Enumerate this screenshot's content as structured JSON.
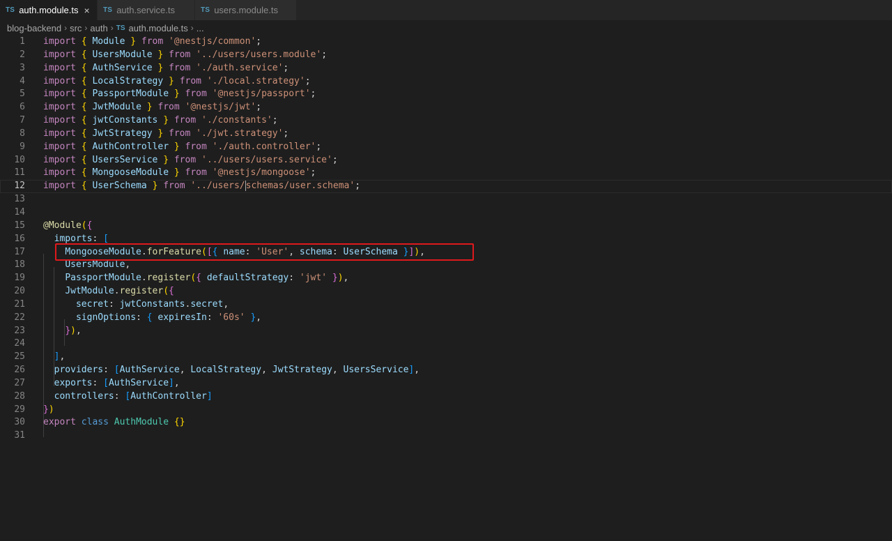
{
  "tabs": [
    {
      "icon": "TS",
      "label": "auth.module.ts",
      "active": true,
      "close": "×"
    },
    {
      "icon": "TS",
      "label": "auth.service.ts",
      "active": false
    },
    {
      "icon": "TS",
      "label": "users.module.ts",
      "active": false
    }
  ],
  "breadcrumb": {
    "items": [
      "blog-backend",
      "src",
      "auth"
    ],
    "file_icon": "TS",
    "file": "auth.module.ts",
    "ellipsis": "..."
  },
  "editor": {
    "current_line": 12,
    "lines": [
      {
        "n": "1",
        "t": [
          [
            "k",
            "import"
          ],
          [
            "p",
            " "
          ],
          [
            "b1",
            "{"
          ],
          [
            "p",
            " "
          ],
          [
            "var",
            "Module"
          ],
          [
            "p",
            " "
          ],
          [
            "b1",
            "}"
          ],
          [
            "p",
            " "
          ],
          [
            "k",
            "from"
          ],
          [
            "p",
            " "
          ],
          [
            "str",
            "'@nestjs/common'"
          ],
          [
            "p",
            ";"
          ]
        ]
      },
      {
        "n": "2",
        "t": [
          [
            "k",
            "import"
          ],
          [
            "p",
            " "
          ],
          [
            "b1",
            "{"
          ],
          [
            "p",
            " "
          ],
          [
            "var",
            "UsersModule"
          ],
          [
            "p",
            " "
          ],
          [
            "b1",
            "}"
          ],
          [
            "p",
            " "
          ],
          [
            "k",
            "from"
          ],
          [
            "p",
            " "
          ],
          [
            "str",
            "'../users/users.module'"
          ],
          [
            "p",
            ";"
          ]
        ]
      },
      {
        "n": "3",
        "t": [
          [
            "k",
            "import"
          ],
          [
            "p",
            " "
          ],
          [
            "b1",
            "{"
          ],
          [
            "p",
            " "
          ],
          [
            "var",
            "AuthService"
          ],
          [
            "p",
            " "
          ],
          [
            "b1",
            "}"
          ],
          [
            "p",
            " "
          ],
          [
            "k",
            "from"
          ],
          [
            "p",
            " "
          ],
          [
            "str",
            "'./auth.service'"
          ],
          [
            "p",
            ";"
          ]
        ]
      },
      {
        "n": "4",
        "t": [
          [
            "k",
            "import"
          ],
          [
            "p",
            " "
          ],
          [
            "b1",
            "{"
          ],
          [
            "p",
            " "
          ],
          [
            "var",
            "LocalStrategy"
          ],
          [
            "p",
            " "
          ],
          [
            "b1",
            "}"
          ],
          [
            "p",
            " "
          ],
          [
            "k",
            "from"
          ],
          [
            "p",
            " "
          ],
          [
            "str",
            "'./local.strategy'"
          ],
          [
            "p",
            ";"
          ]
        ]
      },
      {
        "n": "5",
        "t": [
          [
            "k",
            "import"
          ],
          [
            "p",
            " "
          ],
          [
            "b1",
            "{"
          ],
          [
            "p",
            " "
          ],
          [
            "var",
            "PassportModule"
          ],
          [
            "p",
            " "
          ],
          [
            "b1",
            "}"
          ],
          [
            "p",
            " "
          ],
          [
            "k",
            "from"
          ],
          [
            "p",
            " "
          ],
          [
            "str",
            "'@nestjs/passport'"
          ],
          [
            "p",
            ";"
          ]
        ]
      },
      {
        "n": "6",
        "t": [
          [
            "k",
            "import"
          ],
          [
            "p",
            " "
          ],
          [
            "b1",
            "{"
          ],
          [
            "p",
            " "
          ],
          [
            "var",
            "JwtModule"
          ],
          [
            "p",
            " "
          ],
          [
            "b1",
            "}"
          ],
          [
            "p",
            " "
          ],
          [
            "k",
            "from"
          ],
          [
            "p",
            " "
          ],
          [
            "str",
            "'@nestjs/jwt'"
          ],
          [
            "p",
            ";"
          ]
        ]
      },
      {
        "n": "7",
        "t": [
          [
            "k",
            "import"
          ],
          [
            "p",
            " "
          ],
          [
            "b1",
            "{"
          ],
          [
            "p",
            " "
          ],
          [
            "var",
            "jwtConstants"
          ],
          [
            "p",
            " "
          ],
          [
            "b1",
            "}"
          ],
          [
            "p",
            " "
          ],
          [
            "k",
            "from"
          ],
          [
            "p",
            " "
          ],
          [
            "str",
            "'./constants'"
          ],
          [
            "p",
            ";"
          ]
        ]
      },
      {
        "n": "8",
        "t": [
          [
            "k",
            "import"
          ],
          [
            "p",
            " "
          ],
          [
            "b1",
            "{"
          ],
          [
            "p",
            " "
          ],
          [
            "var",
            "JwtStrategy"
          ],
          [
            "p",
            " "
          ],
          [
            "b1",
            "}"
          ],
          [
            "p",
            " "
          ],
          [
            "k",
            "from"
          ],
          [
            "p",
            " "
          ],
          [
            "str",
            "'./jwt.strategy'"
          ],
          [
            "p",
            ";"
          ]
        ]
      },
      {
        "n": "9",
        "t": [
          [
            "k",
            "import"
          ],
          [
            "p",
            " "
          ],
          [
            "b1",
            "{"
          ],
          [
            "p",
            " "
          ],
          [
            "var",
            "AuthController"
          ],
          [
            "p",
            " "
          ],
          [
            "b1",
            "}"
          ],
          [
            "p",
            " "
          ],
          [
            "k",
            "from"
          ],
          [
            "p",
            " "
          ],
          [
            "str",
            "'./auth.controller'"
          ],
          [
            "p",
            ";"
          ]
        ]
      },
      {
        "n": "10",
        "t": [
          [
            "k",
            "import"
          ],
          [
            "p",
            " "
          ],
          [
            "b1",
            "{"
          ],
          [
            "p",
            " "
          ],
          [
            "var",
            "UsersService"
          ],
          [
            "p",
            " "
          ],
          [
            "b1",
            "}"
          ],
          [
            "p",
            " "
          ],
          [
            "k",
            "from"
          ],
          [
            "p",
            " "
          ],
          [
            "str",
            "'../users/users.service'"
          ],
          [
            "p",
            ";"
          ]
        ]
      },
      {
        "n": "11",
        "t": [
          [
            "k",
            "import"
          ],
          [
            "p",
            " "
          ],
          [
            "b1",
            "{"
          ],
          [
            "p",
            " "
          ],
          [
            "var",
            "MongooseModule"
          ],
          [
            "p",
            " "
          ],
          [
            "b1",
            "}"
          ],
          [
            "p",
            " "
          ],
          [
            "k",
            "from"
          ],
          [
            "p",
            " "
          ],
          [
            "str",
            "'@nestjs/mongoose'"
          ],
          [
            "p",
            ";"
          ]
        ]
      },
      {
        "n": "12",
        "t": [
          [
            "k",
            "import"
          ],
          [
            "p",
            " "
          ],
          [
            "b1",
            "{"
          ],
          [
            "p",
            " "
          ],
          [
            "var",
            "UserSchema"
          ],
          [
            "p",
            " "
          ],
          [
            "b1",
            "}"
          ],
          [
            "p",
            " "
          ],
          [
            "k",
            "from"
          ],
          [
            "p",
            " "
          ],
          [
            "str",
            "'../users/"
          ],
          [
            "cursor",
            ""
          ],
          [
            "str",
            "schemas/user.schema'"
          ],
          [
            "p",
            ";"
          ]
        ]
      },
      {
        "n": "13",
        "t": []
      },
      {
        "n": "14",
        "t": []
      },
      {
        "n": "15",
        "t": [
          [
            "fn",
            "@Module"
          ],
          [
            "b1",
            "("
          ],
          [
            "b2",
            "{"
          ]
        ]
      },
      {
        "n": "16",
        "t": [
          [
            "p",
            "  "
          ],
          [
            "var",
            "imports"
          ],
          [
            "p",
            ": "
          ],
          [
            "b3",
            "["
          ]
        ]
      },
      {
        "n": "17",
        "t": [
          [
            "p",
            "    "
          ],
          [
            "var",
            "MongooseModule"
          ],
          [
            "p",
            "."
          ],
          [
            "fn",
            "forFeature"
          ],
          [
            "b1",
            "("
          ],
          [
            "b2",
            "["
          ],
          [
            "b3",
            "{"
          ],
          [
            "p",
            " "
          ],
          [
            "var",
            "name"
          ],
          [
            "p",
            ": "
          ],
          [
            "str",
            "'User'"
          ],
          [
            "p",
            ", "
          ],
          [
            "var",
            "schema"
          ],
          [
            "p",
            ": "
          ],
          [
            "var",
            "UserSchema"
          ],
          [
            "p",
            " "
          ],
          [
            "b3",
            "}"
          ],
          [
            "b2",
            "]"
          ],
          [
            "b1",
            ")"
          ],
          [
            "p",
            ","
          ]
        ]
      },
      {
        "n": "18",
        "t": [
          [
            "p",
            "    "
          ],
          [
            "var",
            "UsersModule"
          ],
          [
            "p",
            ","
          ]
        ]
      },
      {
        "n": "19",
        "t": [
          [
            "p",
            "    "
          ],
          [
            "var",
            "PassportModule"
          ],
          [
            "p",
            "."
          ],
          [
            "fn",
            "register"
          ],
          [
            "b1",
            "("
          ],
          [
            "b2",
            "{"
          ],
          [
            "p",
            " "
          ],
          [
            "var",
            "defaultStrategy"
          ],
          [
            "p",
            ": "
          ],
          [
            "str",
            "'jwt'"
          ],
          [
            "p",
            " "
          ],
          [
            "b2",
            "}"
          ],
          [
            "b1",
            ")"
          ],
          [
            "p",
            ","
          ]
        ]
      },
      {
        "n": "20",
        "t": [
          [
            "p",
            "    "
          ],
          [
            "var",
            "JwtModule"
          ],
          [
            "p",
            "."
          ],
          [
            "fn",
            "register"
          ],
          [
            "b1",
            "("
          ],
          [
            "b2",
            "{"
          ]
        ]
      },
      {
        "n": "21",
        "t": [
          [
            "p",
            "      "
          ],
          [
            "var",
            "secret"
          ],
          [
            "p",
            ": "
          ],
          [
            "var",
            "jwtConstants"
          ],
          [
            "p",
            "."
          ],
          [
            "var",
            "secret"
          ],
          [
            "p",
            ","
          ]
        ]
      },
      {
        "n": "22",
        "t": [
          [
            "p",
            "      "
          ],
          [
            "var",
            "signOptions"
          ],
          [
            "p",
            ": "
          ],
          [
            "b3",
            "{"
          ],
          [
            "p",
            " "
          ],
          [
            "var",
            "expiresIn"
          ],
          [
            "p",
            ": "
          ],
          [
            "str",
            "'60s'"
          ],
          [
            "p",
            " "
          ],
          [
            "b3",
            "}"
          ],
          [
            "p",
            ","
          ]
        ]
      },
      {
        "n": "23",
        "t": [
          [
            "p",
            "    "
          ],
          [
            "b2",
            "}"
          ],
          [
            "b1",
            ")"
          ],
          [
            "p",
            ","
          ]
        ]
      },
      {
        "n": "24",
        "t": []
      },
      {
        "n": "25",
        "t": [
          [
            "p",
            "  "
          ],
          [
            "b3",
            "]"
          ],
          [
            "p",
            ","
          ]
        ]
      },
      {
        "n": "26",
        "t": [
          [
            "p",
            "  "
          ],
          [
            "var",
            "providers"
          ],
          [
            "p",
            ": "
          ],
          [
            "b3",
            "["
          ],
          [
            "var",
            "AuthService"
          ],
          [
            "p",
            ", "
          ],
          [
            "var",
            "LocalStrategy"
          ],
          [
            "p",
            ", "
          ],
          [
            "var",
            "JwtStrategy"
          ],
          [
            "p",
            ", "
          ],
          [
            "var",
            "UsersService"
          ],
          [
            "b3",
            "]"
          ],
          [
            "p",
            ","
          ]
        ]
      },
      {
        "n": "27",
        "t": [
          [
            "p",
            "  "
          ],
          [
            "var",
            "exports"
          ],
          [
            "p",
            ": "
          ],
          [
            "b3",
            "["
          ],
          [
            "var",
            "AuthService"
          ],
          [
            "b3",
            "]"
          ],
          [
            "p",
            ","
          ]
        ]
      },
      {
        "n": "28",
        "t": [
          [
            "p",
            "  "
          ],
          [
            "var",
            "controllers"
          ],
          [
            "p",
            ": "
          ],
          [
            "b3",
            "["
          ],
          [
            "var",
            "AuthController"
          ],
          [
            "b3",
            "]"
          ]
        ]
      },
      {
        "n": "29",
        "t": [
          [
            "b2",
            "}"
          ],
          [
            "b1",
            ")"
          ]
        ]
      },
      {
        "n": "30",
        "t": [
          [
            "k",
            "export"
          ],
          [
            "p",
            " "
          ],
          [
            "kw",
            "class"
          ],
          [
            "p",
            " "
          ],
          [
            "cls",
            "AuthModule"
          ],
          [
            "p",
            " "
          ],
          [
            "b1",
            "{}"
          ]
        ]
      },
      {
        "n": "31",
        "t": []
      }
    ]
  },
  "colors": {
    "highlight_box": "#e0191c",
    "keyword": "#c586c0",
    "string": "#ce9178",
    "variable": "#9cdcfe",
    "function": "#dcdcaa"
  }
}
